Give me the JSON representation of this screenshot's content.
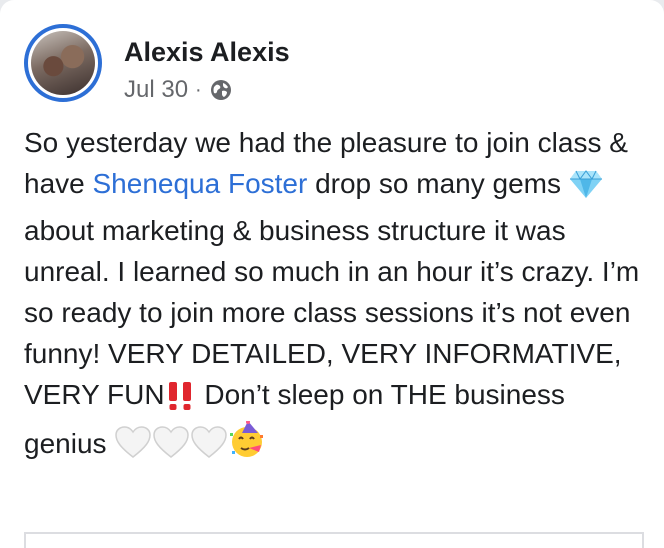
{
  "post": {
    "author": "Alexis Alexis",
    "date": "Jul 30",
    "separator": "·",
    "privacy_icon": "globe-icon",
    "text": {
      "part1": "So yesterday we had the pleasure to join class & have ",
      "mention": "Shenequa Foster",
      "part2": " drop so many gems ",
      "part3": " about marketing & business structure it was unreal. I learned so much in an hour it’s crazy. I’m so ready to join more class sessions it’s not even funny! VERY DETAILED, VERY INFORMATIVE, VERY FUN",
      "part4": " Don’t sleep on THE business genius "
    },
    "emojis": [
      "gem-emoji",
      "double-exclamation-emoji",
      "white-heart-emoji",
      "white-heart-emoji",
      "white-heart-emoji",
      "partying-face-emoji"
    ]
  },
  "colors": {
    "link": "#2d6fd6",
    "avatar_ring": "#2d6fd6",
    "text": "#1c1e21",
    "secondary": "#65676b"
  }
}
